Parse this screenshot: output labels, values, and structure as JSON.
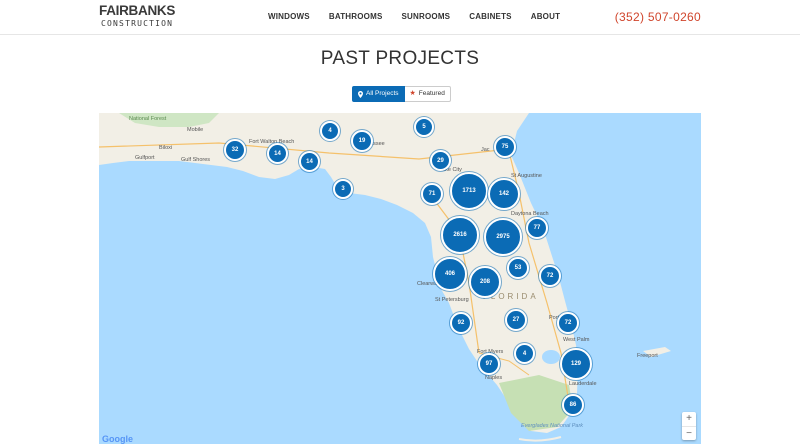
{
  "header": {
    "logo_top": "FAIRBANKS",
    "logo_bottom": "CONSTRUCTION",
    "nav": [
      "WINDOWS",
      "BATHROOMS",
      "SUNROOMS",
      "CABINETS",
      "ABOUT"
    ],
    "phone": "(352) 507-0260",
    "phone_color": "#d0452c"
  },
  "page": {
    "title": "PAST PROJECTS"
  },
  "filter": {
    "all_label": "All Projects",
    "featured_label": "Featured",
    "pin_icon": "map-pin-icon",
    "star_icon": "star-icon",
    "accent": "#0b6bb5"
  },
  "map": {
    "places": {
      "national_forest": "National Forest",
      "mobile": "Mobile",
      "biloxi": "Biloxi",
      "gulfport": "Gulfport",
      "gulf_shores": "Gulf Shores",
      "fort_walton": "Fort Walton Beach",
      "tallahassee": "hassee",
      "jacksonville": "Jac",
      "st_augustine": "St Augustine",
      "lake_city": "Lake City",
      "daytona": "Daytona Beach",
      "clearwater": "Clearwa",
      "st_petersburg": "St Petersburg",
      "florida": "FLORIDA",
      "fort_myers": "Fort Myers",
      "naples": "Naples",
      "west_palm": "West Palm",
      "freeport": "Freeport",
      "everglades": "Everglades National Park",
      "lauderdale": "Lauderdale",
      "port": "Port",
      "orlando": "do"
    },
    "clusters": [
      "32",
      "14",
      "14",
      "4",
      "19",
      "5",
      "29",
      "75",
      "3",
      "71",
      "1713",
      "142",
      "77",
      "2616",
      "2975",
      "53",
      "72",
      "406",
      "208",
      "92",
      "27",
      "72",
      "4",
      "97",
      "129",
      "86"
    ],
    "zoom_in": "+",
    "zoom_out": "−",
    "attribution": "Google"
  }
}
